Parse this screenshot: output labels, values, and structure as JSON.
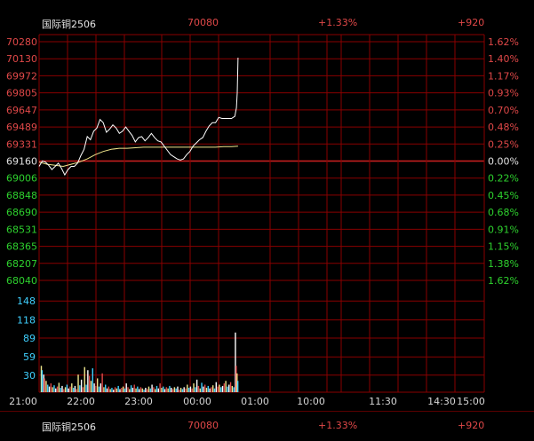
{
  "header_top": {
    "name": "国际铜2506",
    "price": "70080",
    "change_pct": "+1.33%",
    "change": "+920"
  },
  "header_bottom": {
    "name": "国际铜2506",
    "price": "70080",
    "change_pct": "+1.33%",
    "change": "+920"
  },
  "colors": {
    "up": "#e04848",
    "down": "#2ed12e",
    "flat": "#e0e0e0",
    "grid": "#8a0000",
    "volume_axis": "#3fd0ff",
    "price_line": "#ffffff",
    "avg_line": "#f0e68c"
  },
  "chart_data": {
    "type": "line",
    "base_price": 69160,
    "price_ticks_left": [
      {
        "label": "70280",
        "dir": "up"
      },
      {
        "label": "70130",
        "dir": "up"
      },
      {
        "label": "69972",
        "dir": "up"
      },
      {
        "label": "69805",
        "dir": "up"
      },
      {
        "label": "69647",
        "dir": "up"
      },
      {
        "label": "69489",
        "dir": "up"
      },
      {
        "label": "69331",
        "dir": "up"
      },
      {
        "label": "69160",
        "dir": "flat"
      },
      {
        "label": "69006",
        "dir": "down"
      },
      {
        "label": "68848",
        "dir": "down"
      },
      {
        "label": "68690",
        "dir": "down"
      },
      {
        "label": "68531",
        "dir": "down"
      },
      {
        "label": "68365",
        "dir": "down"
      },
      {
        "label": "68207",
        "dir": "down"
      },
      {
        "label": "68040",
        "dir": "down"
      }
    ],
    "pct_ticks_right": [
      {
        "label": "1.62%",
        "dir": "up"
      },
      {
        "label": "1.40%",
        "dir": "up"
      },
      {
        "label": "1.17%",
        "dir": "up"
      },
      {
        "label": "0.93%",
        "dir": "up"
      },
      {
        "label": "0.70%",
        "dir": "up"
      },
      {
        "label": "0.48%",
        "dir": "up"
      },
      {
        "label": "0.25%",
        "dir": "up"
      },
      {
        "label": "0.00%",
        "dir": "flat"
      },
      {
        "label": "0.22%",
        "dir": "down"
      },
      {
        "label": "0.45%",
        "dir": "down"
      },
      {
        "label": "0.68%",
        "dir": "down"
      },
      {
        "label": "0.91%",
        "dir": "down"
      },
      {
        "label": "1.15%",
        "dir": "down"
      },
      {
        "label": "1.38%",
        "dir": "down"
      },
      {
        "label": "1.62%",
        "dir": "down"
      }
    ],
    "ylim": [
      68040,
      70280
    ],
    "volume_ticks": [
      "148",
      "118",
      "89",
      "59",
      "30"
    ],
    "volume_ylim": [
      0,
      178
    ],
    "time_labels": [
      "21:00",
      "22:00",
      "23:00",
      "00:00",
      "01:00",
      "10:00",
      "11:30",
      "14:30",
      "15:00"
    ],
    "session_minutes": 555,
    "price_series": {
      "name": "price",
      "t": [
        0,
        4,
        8,
        12,
        16,
        20,
        24,
        28,
        32,
        36,
        40,
        44,
        48,
        52,
        56,
        60,
        64,
        68,
        72,
        76,
        80,
        84,
        88,
        92,
        96,
        100,
        104,
        108,
        112,
        116,
        120,
        124,
        128,
        132,
        136,
        140,
        144,
        148,
        152,
        156,
        160,
        164,
        168,
        172,
        176,
        180,
        184,
        188,
        192,
        196,
        200,
        204,
        208,
        212,
        216,
        220,
        224,
        228,
        232,
        236,
        240,
        244,
        246,
        247,
        248
      ],
      "values": [
        69110,
        69160,
        69150,
        69120,
        69080,
        69110,
        69140,
        69090,
        69030,
        69080,
        69110,
        69110,
        69140,
        69210,
        69270,
        69390,
        69360,
        69440,
        69470,
        69550,
        69520,
        69430,
        69460,
        69500,
        69470,
        69420,
        69440,
        69480,
        69440,
        69400,
        69340,
        69380,
        69390,
        69350,
        69380,
        69420,
        69380,
        69350,
        69340,
        69300,
        69260,
        69220,
        69200,
        69180,
        69170,
        69180,
        69220,
        69250,
        69300,
        69330,
        69360,
        69380,
        69440,
        69490,
        69520,
        69520,
        69570,
        69560,
        69560,
        69560,
        69560,
        69580,
        69660,
        69800,
        70130
      ]
    },
    "avg_series": {
      "name": "average",
      "t": [
        0,
        10,
        20,
        30,
        40,
        50,
        60,
        70,
        80,
        90,
        100,
        110,
        120,
        130,
        140,
        150,
        160,
        170,
        180,
        190,
        200,
        210,
        220,
        230,
        240,
        248
      ],
      "values": [
        69150,
        69130,
        69120,
        69110,
        69130,
        69150,
        69180,
        69220,
        69250,
        69270,
        69280,
        69280,
        69285,
        69290,
        69290,
        69290,
        69290,
        69290,
        69290,
        69290,
        69290,
        69290,
        69290,
        69295,
        69295,
        69300
      ]
    },
    "volume_series": {
      "name": "volume",
      "t": [
        2,
        3,
        5,
        6,
        8,
        10,
        12,
        14,
        16,
        18,
        20,
        22,
        24,
        26,
        28,
        30,
        32,
        34,
        36,
        38,
        40,
        42,
        44,
        46,
        48,
        50,
        52,
        54,
        56,
        58,
        60,
        62,
        64,
        66,
        68,
        70,
        72,
        74,
        76,
        78,
        80,
        82,
        84,
        86,
        88,
        90,
        92,
        94,
        96,
        98,
        100,
        102,
        104,
        106,
        108,
        110,
        112,
        114,
        116,
        118,
        120,
        122,
        124,
        126,
        128,
        130,
        132,
        134,
        136,
        138,
        140,
        142,
        144,
        146,
        148,
        150,
        152,
        154,
        156,
        158,
        160,
        162,
        164,
        166,
        168,
        170,
        172,
        174,
        176,
        178,
        180,
        182,
        184,
        186,
        188,
        190,
        192,
        194,
        196,
        198,
        200,
        202,
        204,
        206,
        208,
        210,
        212,
        214,
        216,
        218,
        220,
        222,
        224,
        226,
        228,
        230,
        232,
        234,
        236,
        238,
        240,
        242,
        244,
        245,
        246,
        247
      ],
      "values": [
        42,
        35,
        28,
        22,
        18,
        12,
        9,
        14,
        8,
        11,
        6,
        9,
        15,
        7,
        10,
        5,
        8,
        12,
        6,
        9,
        14,
        7,
        10,
        5,
        28,
        11,
        20,
        8,
        40,
        12,
        35,
        26,
        18,
        38,
        14,
        10,
        22,
        9,
        14,
        30,
        8,
        12,
        6,
        9,
        5,
        7,
        4,
        8,
        6,
        10,
        5,
        7,
        9,
        6,
        14,
        8,
        5,
        11,
        7,
        12,
        6,
        9,
        5,
        8,
        6,
        4,
        7,
        5,
        9,
        6,
        12,
        8,
        5,
        10,
        6,
        14,
        7,
        9,
        5,
        8,
        6,
        10,
        7,
        5,
        8,
        6,
        9,
        4,
        7,
        5,
        8,
        6,
        12,
        7,
        9,
        6,
        14,
        8,
        20,
        10,
        6,
        15,
        9,
        12,
        7,
        10,
        6,
        8,
        11,
        6,
        16,
        9,
        12,
        8,
        10,
        14,
        18,
        9,
        12,
        16,
        10,
        8,
        95,
        42,
        30,
        18
      ]
    }
  }
}
